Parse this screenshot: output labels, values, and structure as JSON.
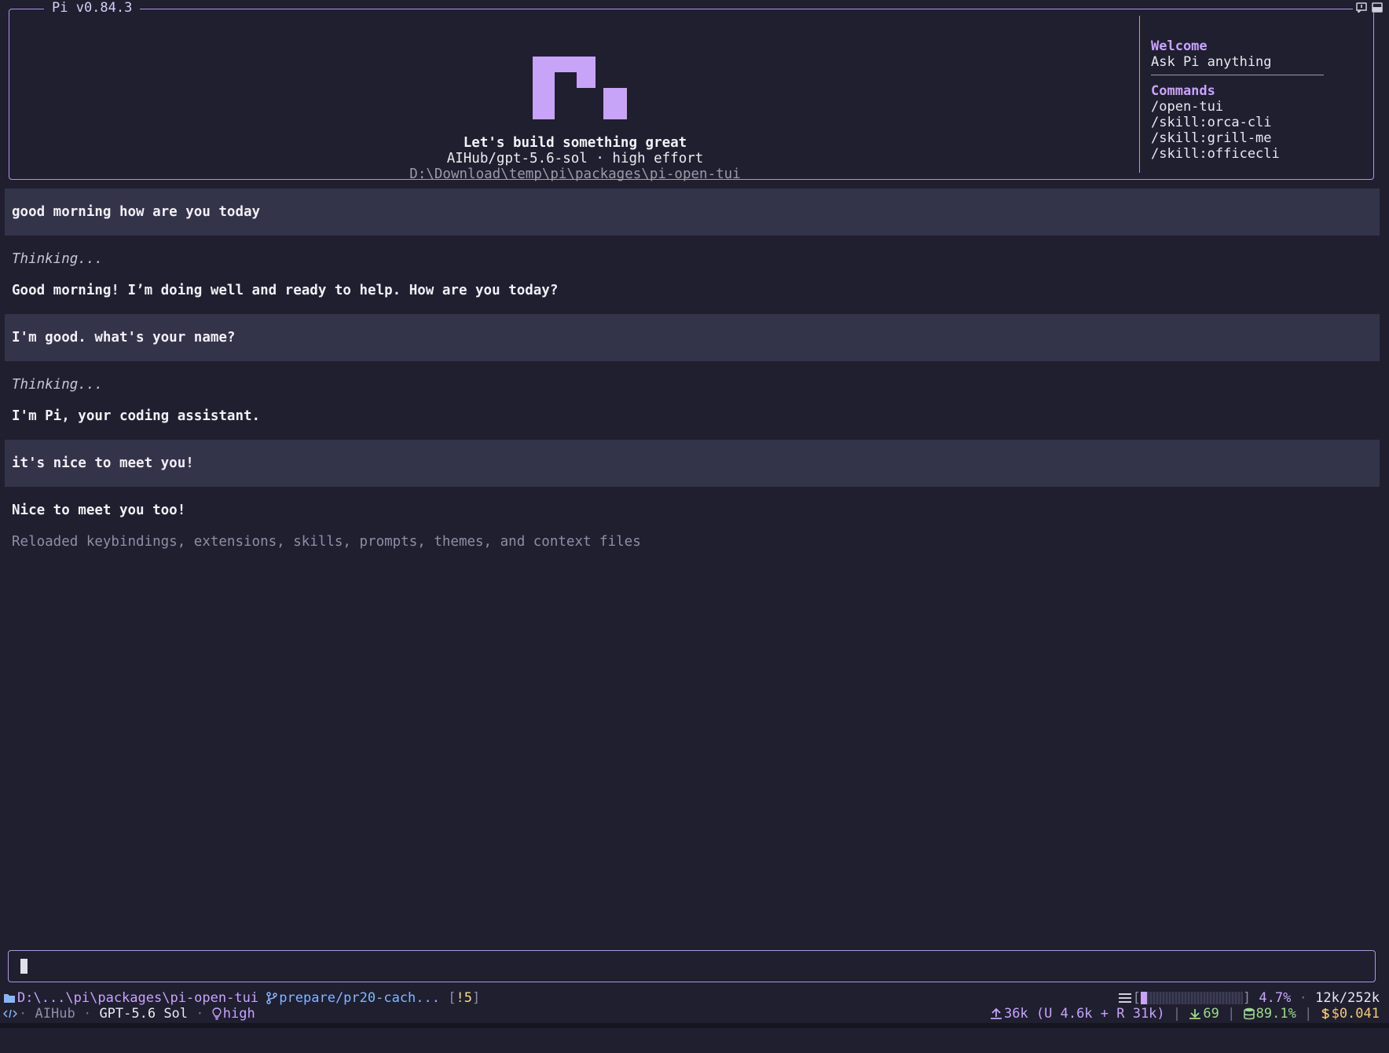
{
  "app": {
    "title": "Pi v0.84.3"
  },
  "header": {
    "tagline": "Let's build something great",
    "model_line": "AIHub/gpt-5.6-sol · high effort",
    "cwd": "D:\\Download\\temp\\pi\\packages\\pi-open-tui",
    "logo_color": "#c8a4f8"
  },
  "side_panel": {
    "welcome_heading": "Welcome",
    "welcome_text": "Ask Pi anything",
    "commands_heading": "Commands",
    "commands": [
      "/open-tui",
      "/skill:orca-cli",
      "/skill:grill-me",
      "/skill:officecli"
    ]
  },
  "chat": {
    "messages": [
      {
        "role": "user",
        "text": "good morning how are you today"
      },
      {
        "role": "thinking",
        "text": "Thinking..."
      },
      {
        "role": "assistant",
        "text": "Good morning! I’m doing well and ready to help. How are you today?"
      },
      {
        "role": "user",
        "text": "I'm good. what's your name?"
      },
      {
        "role": "thinking",
        "text": "Thinking..."
      },
      {
        "role": "assistant",
        "text": "I'm Pi, your coding assistant."
      },
      {
        "role": "user",
        "text": "it's nice to meet you!"
      },
      {
        "role": "assistant",
        "text": "Nice to meet you too!"
      },
      {
        "role": "system",
        "text": "Reloaded keybindings, extensions, skills, prompts, themes, and context files"
      }
    ]
  },
  "input": {
    "value": ""
  },
  "status": {
    "path": "D:\\...\\pi\\packages\\pi-open-tui",
    "branch": "prepare/pr20-cach...",
    "git_open": "[",
    "git_changes": "!5",
    "git_close": "]",
    "context_open": "[",
    "context_close": "]",
    "context_fraction": 0.047,
    "context_percent": "4.7%",
    "context_tokens": "12k/252k",
    "provider": "AIHub",
    "model": "GPT-5.6 Sol",
    "effort": "high",
    "upload": "36k (U 4.6k + R 31k)",
    "download": "69",
    "cache": "89.1%",
    "cost": "$0.041",
    "dot": "·",
    "pipe": "|"
  },
  "icons": {
    "folder": "folder-icon",
    "branch": "git-branch-icon",
    "code": "code-icon",
    "bulb": "lightbulb-icon",
    "menu": "hamburger-menu-icon",
    "upload": "upload-icon",
    "download": "download-icon",
    "database": "database-icon",
    "dollar": "dollar-icon"
  }
}
